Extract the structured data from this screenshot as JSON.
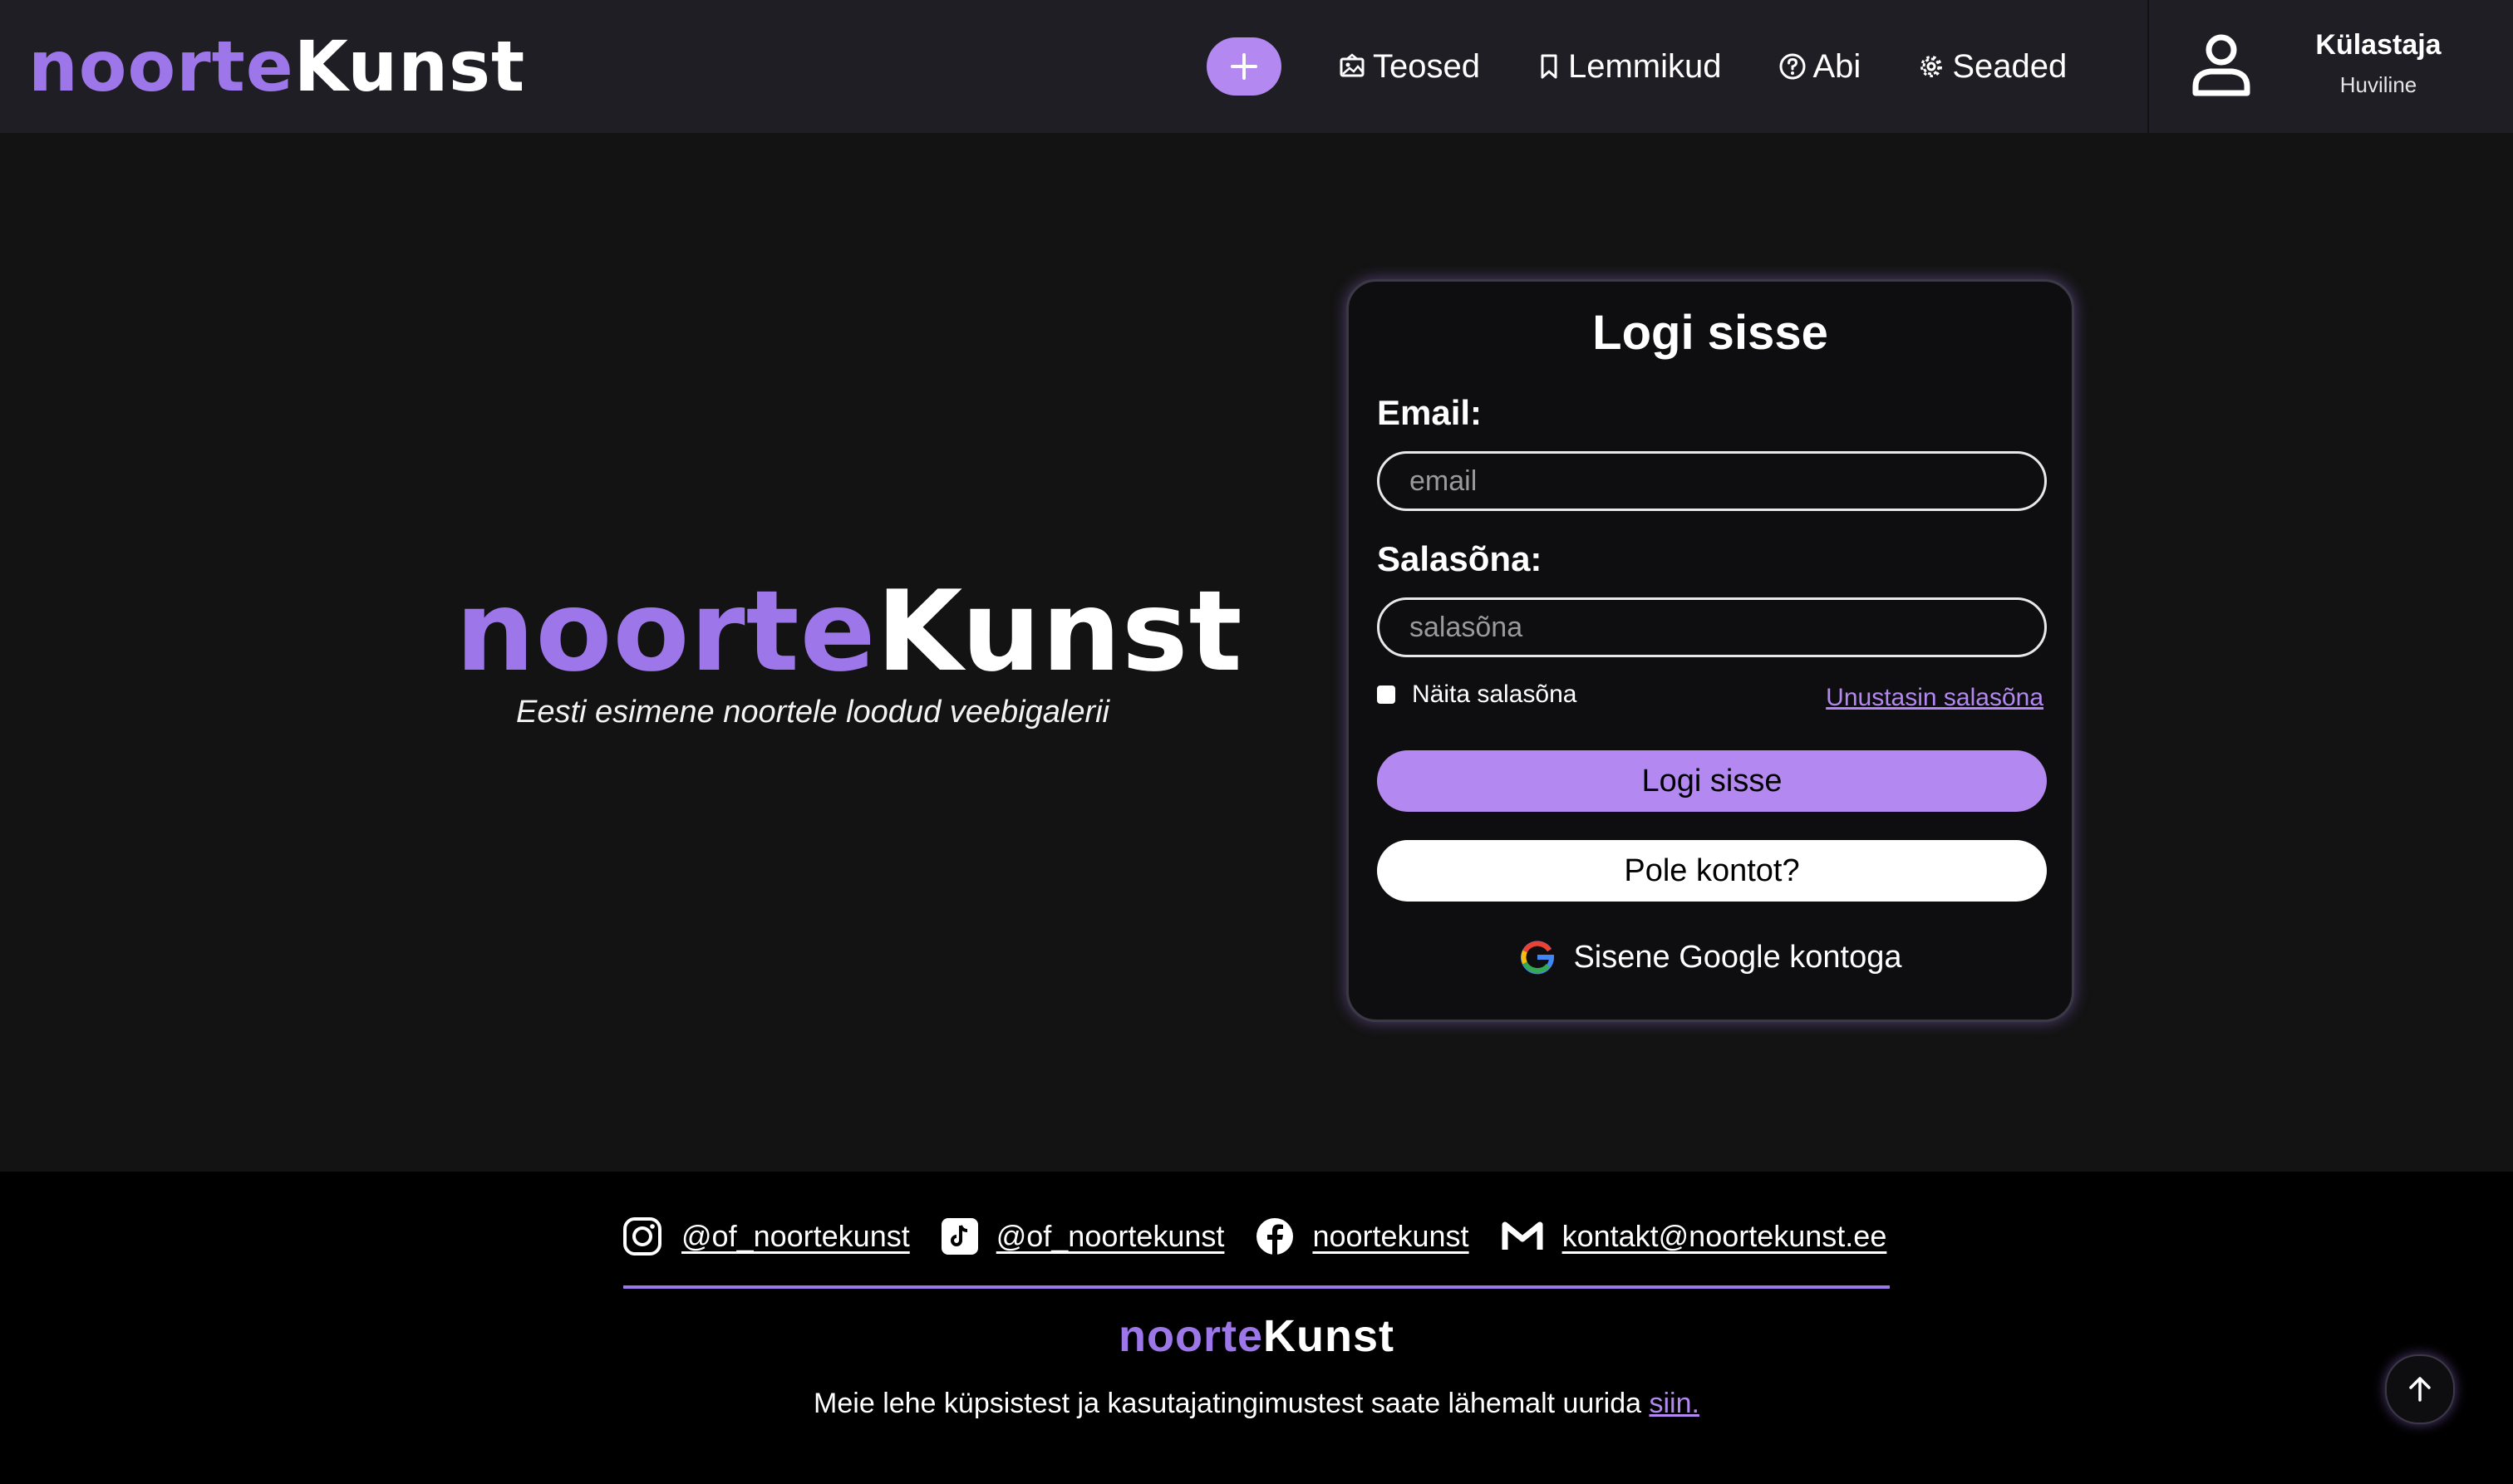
{
  "brand": {
    "part1": "noorte",
    "part2": "Kunst"
  },
  "nav": {
    "items": [
      {
        "label": "Teosed",
        "icon": "gallery-icon"
      },
      {
        "label": "Lemmikud",
        "icon": "bookmark-icon"
      },
      {
        "label": "Abi",
        "icon": "help-icon"
      },
      {
        "label": "Seaded",
        "icon": "gear-icon"
      }
    ]
  },
  "user": {
    "name": "Külastaja",
    "role": "Huviline"
  },
  "hero": {
    "tagline": "Eesti esimene noortele loodud veebigalerii"
  },
  "login": {
    "title": "Logi sisse",
    "email_label": "Email:",
    "email_placeholder": "email",
    "password_label": "Salasõna:",
    "password_placeholder": "salasõna",
    "show_password_label": "Näita salasõna",
    "forgot_link": "Unustasin salasõna",
    "submit_label": "Logi sisse",
    "register_label": "Pole kontot?",
    "google_label": "Sisene Google kontoga"
  },
  "footer": {
    "instagram": "@of_noortekunst",
    "tiktok": "@of_noortekunst",
    "facebook": "noortekunst",
    "email": "kontakt@noortekunst.ee",
    "legal_text": "Meie lehe küpsistest ja kasutajatingimustest saate lähemalt uurida",
    "legal_link": "siin."
  },
  "colors": {
    "accent": "#b388f0",
    "brand_purple": "#9d77ea",
    "header_bg": "#1f1e24",
    "page_bg": "#131313",
    "footer_bg": "#000000"
  }
}
